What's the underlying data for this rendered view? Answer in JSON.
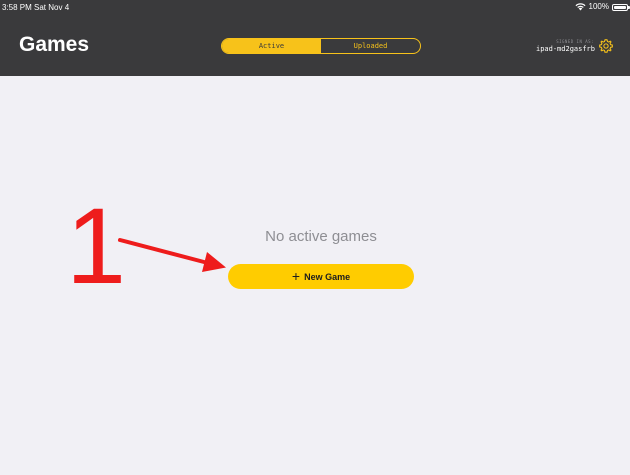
{
  "status_bar": {
    "time": "3:58 PM  Sat Nov 4",
    "battery": "100%",
    "icons": [
      "wifi-icon",
      "battery-icon"
    ]
  },
  "header": {
    "title": "Games",
    "tabs": [
      {
        "label": "Active",
        "selected": true
      },
      {
        "label": "Uploaded",
        "selected": false
      }
    ],
    "signed_in_caption": "SIGNED IN AS:",
    "user_id": "ipad-md2gasfrb",
    "settings_icon": "gear-icon"
  },
  "main": {
    "empty_message": "No active games",
    "new_game_label": "New Game",
    "new_game_icon": "plus-icon"
  },
  "annotation": {
    "number": "1",
    "color": "#ee1c1c"
  },
  "colors": {
    "header_background": "#3a3a3c",
    "accent": "#ffcc00",
    "page_background": "#f1f0f5"
  }
}
